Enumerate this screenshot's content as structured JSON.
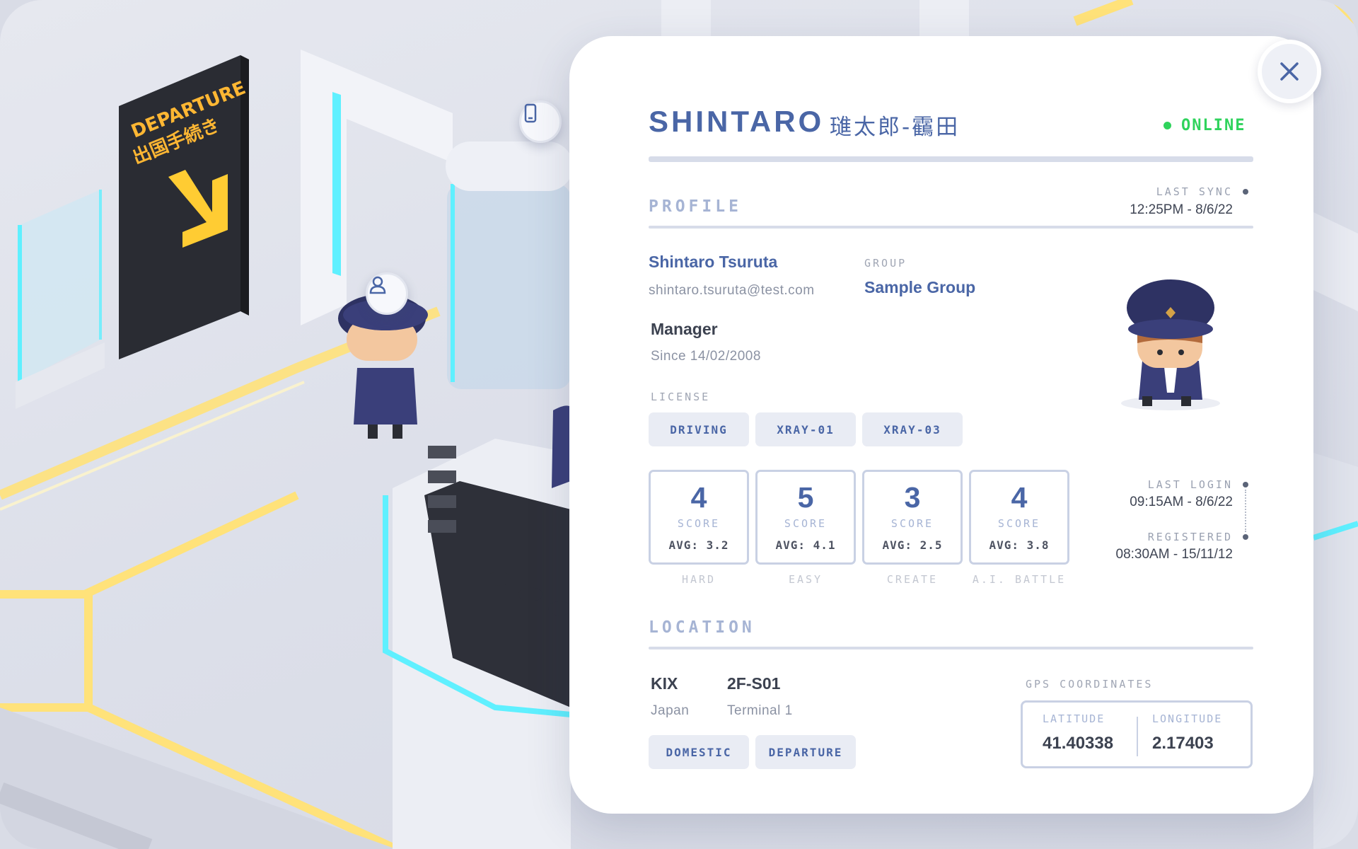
{
  "header": {
    "name": "SHINTARO",
    "name_jp": "璡太郎-靍田",
    "status": "ONLINE"
  },
  "profile": {
    "section_title": "PROFILE",
    "last_sync_label": "LAST SYNC",
    "last_sync_value": "12:25PM - 8/6/22",
    "full_name": "Shintaro Tsuruta",
    "email": "shintaro.tsuruta@test.com",
    "group_label": "GROUP",
    "group_value": "Sample Group",
    "role": "Manager",
    "since": "Since 14/02/2008",
    "license_label": "LICENSE",
    "licenses": [
      "DRIVING",
      "XRAY-01",
      "XRAY-03"
    ]
  },
  "scores": [
    {
      "value": "4",
      "label": "SCORE",
      "avg": "AVG: 3.2",
      "mode": "HARD"
    },
    {
      "value": "5",
      "label": "SCORE",
      "avg": "AVG: 4.1",
      "mode": "EASY"
    },
    {
      "value": "3",
      "label": "SCORE",
      "avg": "AVG: 2.5",
      "mode": "CREATE"
    },
    {
      "value": "4",
      "label": "SCORE",
      "avg": "AVG: 3.8",
      "mode": "A.I. BATTLE"
    }
  ],
  "activity": {
    "last_login_label": "LAST LOGIN",
    "last_login_value": "09:15AM - 8/6/22",
    "registered_label": "REGISTERED",
    "registered_value": "08:30AM - 15/11/12"
  },
  "location": {
    "section_title": "LOCATION",
    "airport": "KIX",
    "country": "Japan",
    "gate": "2F-S01",
    "terminal": "Terminal 1",
    "tags": [
      "DOMESTIC",
      "DEPARTURE"
    ],
    "gps_label": "GPS COORDINATES",
    "latitude_label": "LATITUDE",
    "latitude": "41.40338",
    "longitude_label": "LONGITUDE",
    "longitude": "2.17403"
  },
  "scene": {
    "sign_line1": "DEPARTURE",
    "sign_line2": "出国手続き"
  },
  "colors": {
    "accent": "#4a66a6",
    "online": "#2fd35c",
    "neon_yellow": "#ffd84d",
    "neon_cyan": "#5ff0ff"
  },
  "icons": [
    "close-icon",
    "phone-icon",
    "user-icon",
    "status-dot-icon",
    "arrow-down-right-icon"
  ]
}
